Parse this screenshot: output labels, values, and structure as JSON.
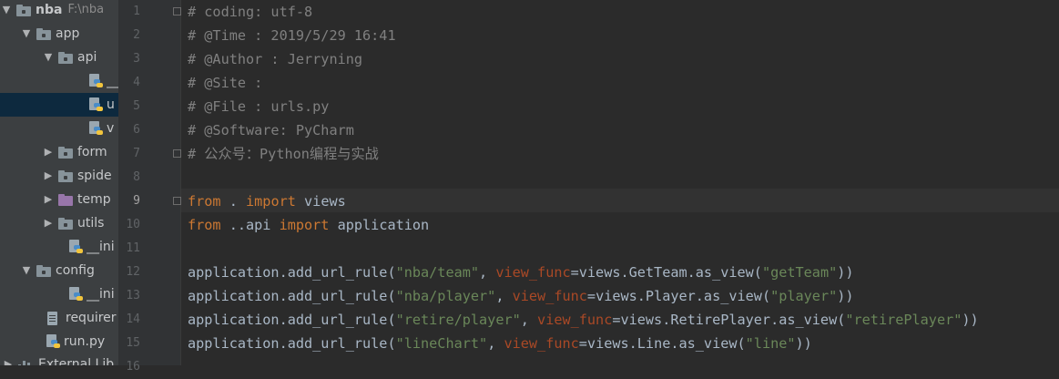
{
  "project_tree": {
    "root": {
      "label": "nba",
      "path": "F:\\nba"
    },
    "app": "app",
    "api": "api",
    "api_files": [
      "__",
      "u",
      "v"
    ],
    "app_folders": [
      "form",
      "spide",
      "temp",
      "utils"
    ],
    "app_init": "__ini",
    "config": "config",
    "config_init": "__ini",
    "requirements": "requirer",
    "run": "run.py",
    "external": "External Lib"
  },
  "editor": {
    "line_numbers": [
      "1",
      "2",
      "3",
      "4",
      "5",
      "6",
      "7",
      "8",
      "9",
      "10",
      "11",
      "12",
      "13",
      "14",
      "15",
      "16"
    ],
    "current_line": 9,
    "lines": [
      [
        {
          "t": "# coding: utf-8",
          "c": "comment"
        }
      ],
      [
        {
          "t": "# @Time : 2019/5/29 16:41",
          "c": "comment"
        }
      ],
      [
        {
          "t": "# @Author : Jerryning",
          "c": "comment"
        }
      ],
      [
        {
          "t": "# @Site :",
          "c": "comment"
        }
      ],
      [
        {
          "t": "# @File : urls.py",
          "c": "comment"
        }
      ],
      [
        {
          "t": "# @Software: PyCharm",
          "c": "comment"
        }
      ],
      [
        {
          "t": "# 公众号：Python编程与实战",
          "c": "comment"
        }
      ],
      [],
      [
        {
          "t": "from",
          "c": "kw"
        },
        {
          "t": " . ",
          "c": ""
        },
        {
          "t": "import",
          "c": "kw"
        },
        {
          "t": " views",
          "c": ""
        }
      ],
      [
        {
          "t": "from",
          "c": "kw"
        },
        {
          "t": " ..api ",
          "c": ""
        },
        {
          "t": "import",
          "c": "kw"
        },
        {
          "t": " application",
          "c": ""
        }
      ],
      [],
      [
        {
          "t": "application.add_url_rule(",
          "c": ""
        },
        {
          "t": "\"nba/team\"",
          "c": "str"
        },
        {
          "t": ", ",
          "c": ""
        },
        {
          "t": "view_func",
          "c": "param"
        },
        {
          "t": "=views.GetTeam.as_view(",
          "c": ""
        },
        {
          "t": "\"getTeam\"",
          "c": "str"
        },
        {
          "t": "))",
          "c": ""
        }
      ],
      [
        {
          "t": "application.add_url_rule(",
          "c": ""
        },
        {
          "t": "\"nba/player\"",
          "c": "str"
        },
        {
          "t": ", ",
          "c": ""
        },
        {
          "t": "view_func",
          "c": "param"
        },
        {
          "t": "=views.Player.as_view(",
          "c": ""
        },
        {
          "t": "\"player\"",
          "c": "str"
        },
        {
          "t": "))",
          "c": ""
        }
      ],
      [
        {
          "t": "application.add_url_rule(",
          "c": ""
        },
        {
          "t": "\"retire/player\"",
          "c": "str"
        },
        {
          "t": ", ",
          "c": ""
        },
        {
          "t": "view_func",
          "c": "param"
        },
        {
          "t": "=views.RetirePlayer.as_view(",
          "c": ""
        },
        {
          "t": "\"retirePlayer\"",
          "c": "str"
        },
        {
          "t": "))",
          "c": ""
        }
      ],
      [
        {
          "t": "application.add_url_rule(",
          "c": ""
        },
        {
          "t": "\"lineChart\"",
          "c": "str"
        },
        {
          "t": ", ",
          "c": ""
        },
        {
          "t": "view_func",
          "c": "param"
        },
        {
          "t": "=views.Line.as_view(",
          "c": ""
        },
        {
          "t": "\"line\"",
          "c": "str"
        },
        {
          "t": "))",
          "c": ""
        }
      ],
      []
    ]
  },
  "colors": {
    "comment": "#808080",
    "keyword": "#cc7832",
    "string": "#6a8759",
    "param": "#aa4926",
    "default": "#a9b7c6"
  }
}
